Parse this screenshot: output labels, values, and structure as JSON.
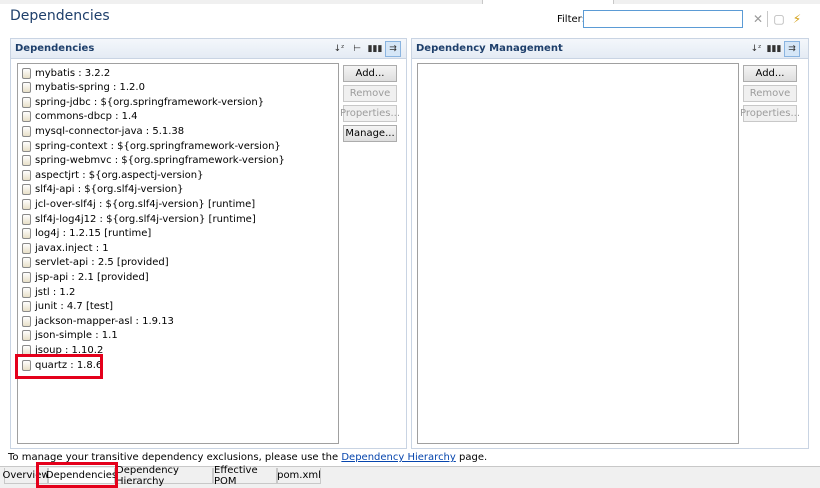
{
  "header": {
    "title": "Dependencies",
    "filter_label": "Filter:",
    "filter_value": ""
  },
  "dependencies_section": {
    "title": "Dependencies",
    "items": [
      "mybatis : 3.2.2",
      "mybatis-spring : 1.2.0",
      "spring-jdbc : ${org.springframework-version}",
      "commons-dbcp : 1.4",
      "mysql-connector-java : 5.1.38",
      "spring-context : ${org.springframework-version}",
      "spring-webmvc : ${org.springframework-version}",
      "aspectjrt : ${org.aspectj-version}",
      "slf4j-api : ${org.slf4j-version}",
      "jcl-over-slf4j : ${org.slf4j-version} [runtime]",
      "slf4j-log4j12 : ${org.slf4j-version} [runtime]",
      "log4j : 1.2.15 [runtime]",
      "javax.inject : 1",
      "servlet-api : 2.5 [provided]",
      "jsp-api : 2.1 [provided]",
      "jstl : 1.2",
      "junit : 4.7 [test]",
      "jackson-mapper-asl : 1.9.13",
      "json-simple : 1.1",
      "jsoup : 1.10.2",
      "quartz : 1.8.6"
    ],
    "buttons": {
      "add": "Add...",
      "remove": "Remove",
      "properties": "Properties...",
      "manage": "Manage..."
    }
  },
  "management_section": {
    "title": "Dependency Management",
    "buttons": {
      "add": "Add...",
      "remove": "Remove",
      "properties": "Properties..."
    }
  },
  "footer": {
    "text_before": "To manage your transitive dependency exclusions, please use the ",
    "link": "Dependency Hierarchy",
    "text_after": " page."
  },
  "tabs": [
    "Overview",
    "Dependencies",
    "Dependency Hierarchy",
    "Effective POM",
    "pom.xml"
  ],
  "active_tab": "Dependencies",
  "colors": {
    "title": "#1e3f6b",
    "highlight": "#e4001b",
    "link": "#0645ad"
  }
}
